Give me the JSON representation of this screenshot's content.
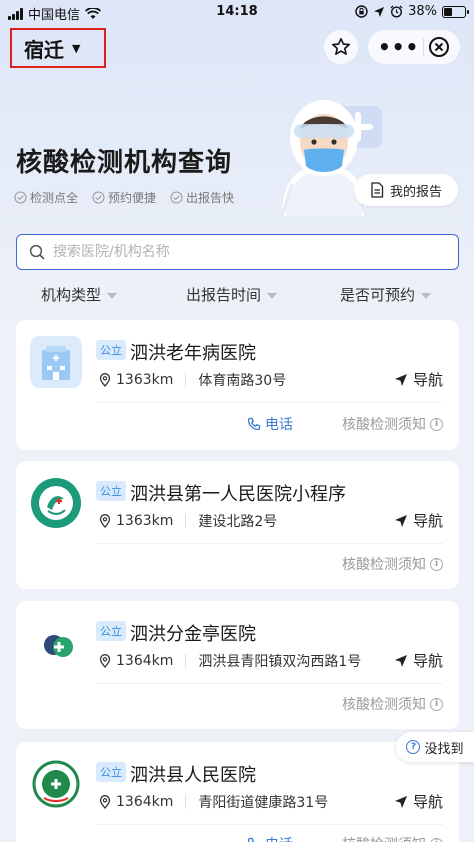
{
  "status_bar": {
    "carrier": "中国电信",
    "time": "14:18",
    "battery": "38%",
    "battery_level": 0.38
  },
  "nav": {
    "city": "宿迁",
    "more_icon": "more-dots-icon",
    "close_icon": "close-icon",
    "favorite_icon": "star-icon"
  },
  "hero": {
    "title": "核酸检测机构查询",
    "features": [
      "检测点全",
      "预约便捷",
      "出报告快"
    ],
    "report_button": "我的报告"
  },
  "search": {
    "placeholder": "搜索医院/机构名称",
    "value": ""
  },
  "filters": [
    "机构类型",
    "出报告时间",
    "是否可预约"
  ],
  "hospitals": [
    {
      "tag": "公立",
      "name": "泗洪老年病医院",
      "distance": "1363km",
      "address": "体育南路30号",
      "nav_label": "导航",
      "phone_label": "电话",
      "notice_label": "核酸检测须知",
      "logo": "hospital-building-logo"
    },
    {
      "tag": "公立",
      "name": "泗洪县第一人民医院小程序",
      "distance": "1363km",
      "address": "建设北路2号",
      "nav_label": "导航",
      "notice_label": "核酸检测须知",
      "logo": "first-peoples-hospital-logo"
    },
    {
      "tag": "公立",
      "name": "泗洪分金亭医院",
      "distance": "1364km",
      "address": "泗洪县青阳镇双沟西路1号",
      "nav_label": "导航",
      "notice_label": "核酸检测须知",
      "logo": "medical-cross-logo"
    },
    {
      "tag": "公立",
      "name": "泗洪县人民医院",
      "distance": "1364km",
      "address": "青阳街道健康路31号",
      "nav_label": "导航",
      "phone_label": "电话",
      "notice_label": "核酸检测须知",
      "logo": "peoples-hospital-seal-logo"
    }
  ],
  "help": {
    "label": "没找到"
  },
  "colors": {
    "accent_blue": "#3b78d6",
    "tag_bg": "#d8eafc",
    "tag_text": "#3b8de0",
    "highlight_red": "#e02020"
  }
}
